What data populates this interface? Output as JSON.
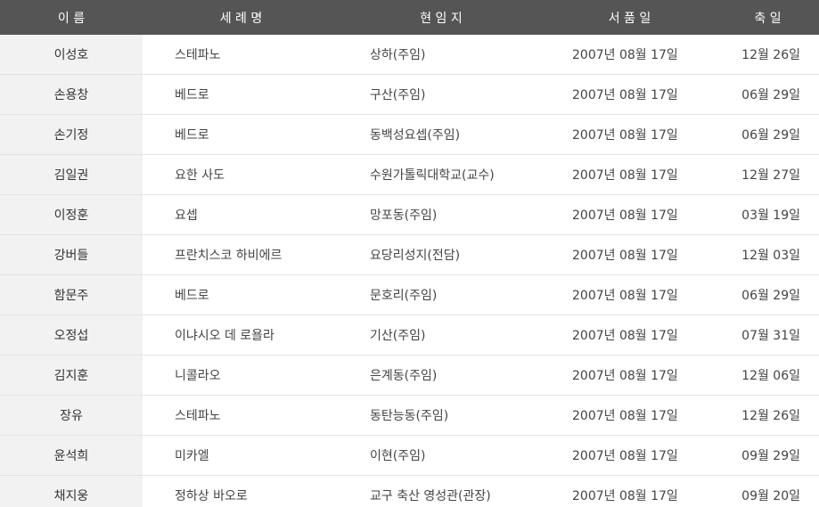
{
  "headers": {
    "name": "이 름",
    "baptismal": "세 례 명",
    "current": "현 임 지",
    "ordination": "서 품 일",
    "feast": "축 일"
  },
  "rows": [
    {
      "name": "이성호",
      "baptismal": "스테파노",
      "current": "상하(주임)",
      "ordination": "2007년 08월 17일",
      "feast": "12월 26일"
    },
    {
      "name": "손용창",
      "baptismal": "베드로",
      "current": "구산(주임)",
      "ordination": "2007년 08월 17일",
      "feast": "06월 29일"
    },
    {
      "name": "손기정",
      "baptismal": "베드로",
      "current": "동백성요셉(주임)",
      "ordination": "2007년 08월 17일",
      "feast": "06월 29일"
    },
    {
      "name": "김일권",
      "baptismal": "요한 사도",
      "current": "수원가톨릭대학교(교수)",
      "ordination": "2007년 08월 17일",
      "feast": "12월 27일"
    },
    {
      "name": "이정훈",
      "baptismal": "요셉",
      "current": "망포동(주임)",
      "ordination": "2007년 08월 17일",
      "feast": "03월 19일"
    },
    {
      "name": "강버들",
      "baptismal": "프란치스코 하비에르",
      "current": "요당리성지(전담)",
      "ordination": "2007년 08월 17일",
      "feast": "12월 03일"
    },
    {
      "name": "함문주",
      "baptismal": "베드로",
      "current": "문호리(주임)",
      "ordination": "2007년 08월 17일",
      "feast": "06월 29일"
    },
    {
      "name": "오정섭",
      "baptismal": "이냐시오 데 로욜라",
      "current": "기산(주임)",
      "ordination": "2007년 08월 17일",
      "feast": "07월 31일"
    },
    {
      "name": "김지훈",
      "baptismal": "니콜라오",
      "current": "은계동(주임)",
      "ordination": "2007년 08월 17일",
      "feast": "12월 06일"
    },
    {
      "name": "장유",
      "baptismal": "스테파노",
      "current": "동탄능동(주임)",
      "ordination": "2007년 08월 17일",
      "feast": "12월 26일"
    },
    {
      "name": "윤석희",
      "baptismal": "미카엘",
      "current": "이현(주임)",
      "ordination": "2007년 08월 17일",
      "feast": "09월 29일"
    },
    {
      "name": "채지웅",
      "baptismal": "정하상 바오로",
      "current": "교구 축산 영성관(관장)",
      "ordination": "2007년 08월 17일",
      "feast": "09월 20일"
    }
  ],
  "colors": {
    "header_bg": "#555555",
    "header_text": "#ffffff",
    "name_col_bg": "#f2f2f2",
    "row_border": "#e3e3e3"
  }
}
